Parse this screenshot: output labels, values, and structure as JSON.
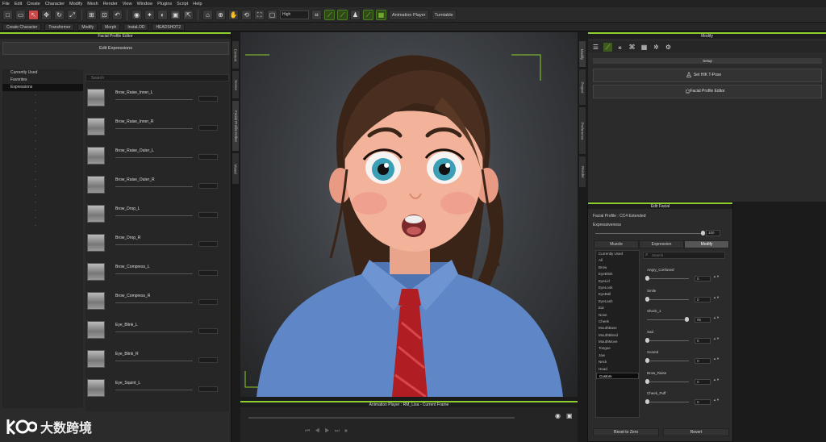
{
  "menu": [
    "File",
    "Edit",
    "Create",
    "Character",
    "Modify",
    "Mesh",
    "Render",
    "View",
    "Window",
    "Plugins",
    "Script",
    "Help"
  ],
  "toolbar": {
    "quality": "High",
    "animation_player": "Animation Player",
    "turntable": "Turntable"
  },
  "toolbar2": {
    "items": [
      "Create Character",
      "Transformer",
      "Modify",
      "Morph",
      "InstaLOD",
      "HEADSHOT2"
    ]
  },
  "left_panel": {
    "title": "Facial Profile Editor",
    "edit_expressions": "Edit Expressions",
    "categories": [
      "Currently Used",
      "Favorites",
      "Expressions"
    ],
    "search_placeholder": "Search",
    "expressions": [
      {
        "name": "Brow_Raise_Inner_L"
      },
      {
        "name": "Brow_Raise_Inner_R"
      },
      {
        "name": "Brow_Raise_Outer_L"
      },
      {
        "name": "Brow_Raise_Outer_R"
      },
      {
        "name": "Brow_Drop_L"
      },
      {
        "name": "Brow_Drop_R"
      },
      {
        "name": "Brow_Compress_L"
      },
      {
        "name": "Brow_Compress_R"
      },
      {
        "name": "Eye_Blink_L"
      },
      {
        "name": "Eye_Blink_R"
      },
      {
        "name": "Eye_Squint_L"
      }
    ]
  },
  "side_tabs_left": [
    "Content",
    "Scene",
    "Facial Profile Editor",
    "Visual"
  ],
  "side_tabs_right": [
    "Modify",
    "Project",
    "Preference",
    "Render"
  ],
  "right_panel": {
    "title": "Modify",
    "setup": "Setup",
    "set_hik": "Set HIK T-Pose",
    "facial_profile_editor": "Facial Profile Editor"
  },
  "edit_facial": {
    "title": "Edit Facial",
    "profile": "Facial Profile : CC4 Extended",
    "expressiveness_label": "Expressiveness",
    "expressiveness_value": "100",
    "expressiveness_level": 1.0,
    "tabs": [
      "Muscle",
      "Expression",
      "Modify"
    ],
    "active_tab": "Modify",
    "categories": [
      "Currently Used",
      "All",
      "Brow",
      "EyeBlink",
      "EyeLid",
      "EyeLook",
      "EyeBall",
      "EyeLash",
      "Ear",
      "Nose",
      "Cheek",
      "MouthBase",
      "MouthBlend",
      "MouthMove",
      "Tongue",
      "Jaw",
      "Neck",
      "Head",
      "Custom"
    ],
    "selected_category": "Custom",
    "search_placeholder": "Search",
    "sliders": [
      {
        "name": "Angry_Confused",
        "value": "0",
        "level": 0.0
      },
      {
        "name": "Smile",
        "value": "0",
        "level": 0.0
      },
      {
        "name": "Shock_1",
        "value": "95",
        "level": 0.95
      },
      {
        "name": "Sad",
        "value": "0",
        "level": 0.0
      },
      {
        "name": "Scared",
        "value": "0",
        "level": 0.0
      },
      {
        "name": "Brow_Raise",
        "value": "0",
        "level": 0.0
      },
      {
        "name": "Cheek_Puff",
        "value": "0",
        "level": 0.0
      }
    ],
    "reset_to_zero": "Reset to Zero",
    "revert": "Revert"
  },
  "animation_player": {
    "title": "Animation Player : RM_Lisa - Current Frame"
  },
  "watermark": {
    "logo": "大数跨境"
  },
  "colors": {
    "accent": "#8ccf2e",
    "shirt": "#5f86c6",
    "tie": "#b01e24"
  }
}
